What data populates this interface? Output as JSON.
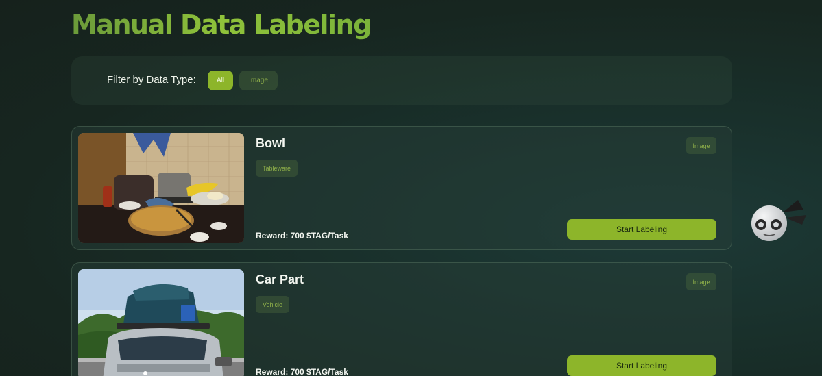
{
  "page": {
    "title": "Manual Data Labeling"
  },
  "filter": {
    "label": "Filter by Data Type:",
    "options": [
      "All",
      "Image"
    ],
    "selected": "All"
  },
  "tasks": [
    {
      "title": "Bowl",
      "category": "Tableware",
      "data_type": "Image",
      "reward": "Reward: 700 $TAG/Task",
      "button_label": "Start Labeling"
    },
    {
      "title": "Car Part",
      "category": "Vehicle",
      "data_type": "Image",
      "reward": "Reward: 700 $TAG/Task",
      "button_label": "Start Labeling"
    }
  ],
  "colors": {
    "accent": "#8db52a",
    "title_gradient_start": "#6b9a3a",
    "title_gradient_end": "#8fc23a",
    "chip_text": "#8fb04a"
  },
  "icons": {
    "mascot": "robot-mascot-icon"
  }
}
